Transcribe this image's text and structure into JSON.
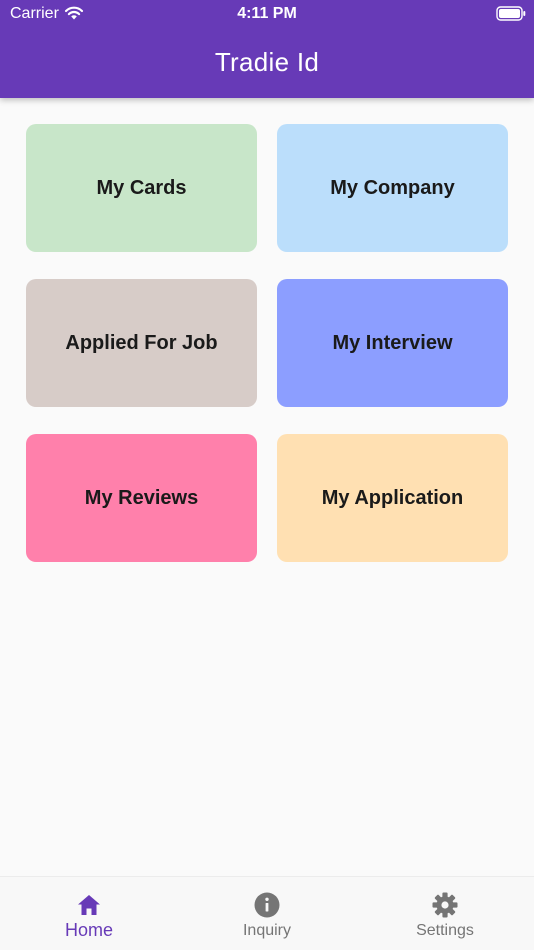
{
  "status_bar": {
    "carrier": "Carrier",
    "time": "4:11 PM",
    "icons": [
      "wifi-icon",
      "battery-icon"
    ]
  },
  "app_bar": {
    "title": "Tradie Id",
    "color": "#673ab7"
  },
  "tiles": [
    {
      "label": "My Cards",
      "color": "#c8e6c9"
    },
    {
      "label": "My Company",
      "color": "#bbdefb"
    },
    {
      "label": "Applied For Job",
      "color": "#d7ccc8"
    },
    {
      "label": "My Interview",
      "color": "#8c9eff"
    },
    {
      "label": "My Reviews",
      "color": "#ff80ab"
    },
    {
      "label": "My Application",
      "color": "#ffe0b2"
    }
  ],
  "bottom_nav": {
    "active_index": 0,
    "active_color": "#673ab7",
    "items": [
      {
        "label": "Home",
        "icon": "home-icon"
      },
      {
        "label": "Inquiry",
        "icon": "info-icon"
      },
      {
        "label": "Settings",
        "icon": "gear-icon"
      }
    ]
  }
}
